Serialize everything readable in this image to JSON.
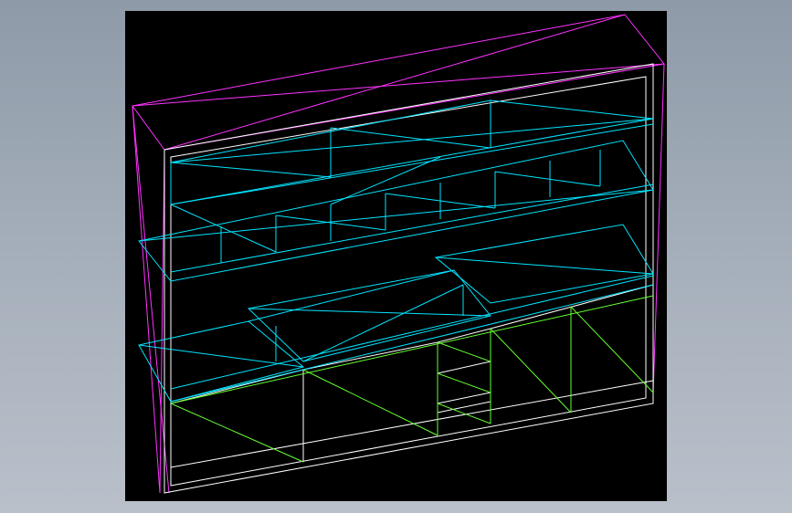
{
  "canvas": {
    "background_color": "#000000",
    "app_background_gradient": [
      "#8e9aa8",
      "#b9c0ca"
    ]
  },
  "colors": {
    "outer_frame": "#ff33ff",
    "shelf_frame": "#00e5ff",
    "cabinet_frame": "#ffffff",
    "drawer_frame": "#66ff33"
  }
}
